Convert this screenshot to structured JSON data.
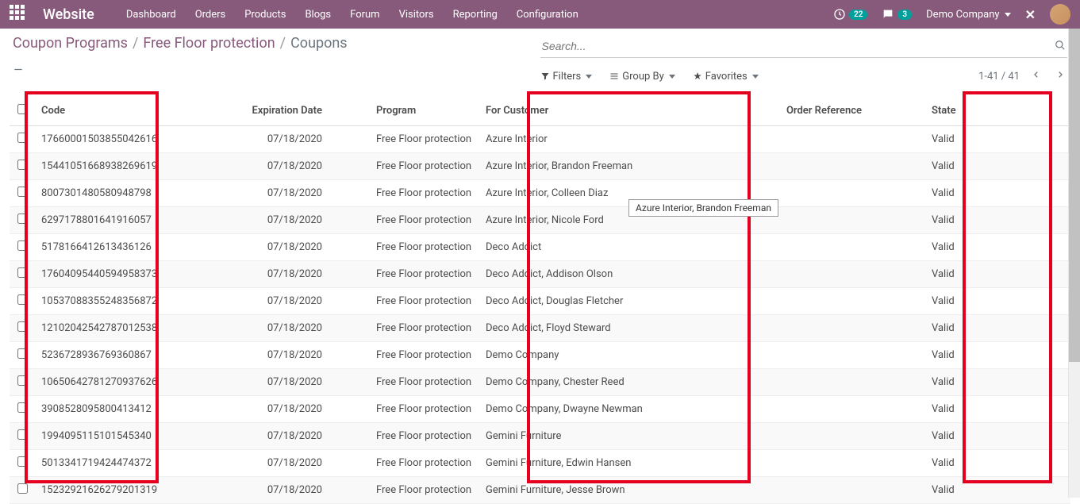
{
  "navbar": {
    "brand": "Website",
    "menu": [
      "Dashboard",
      "Orders",
      "Products",
      "Blogs",
      "Forum",
      "Visitors",
      "Reporting",
      "Configuration"
    ],
    "clock_count": "22",
    "chat_count": "3",
    "company": "Demo Company"
  },
  "breadcrumb": {
    "items": [
      {
        "label": "Coupon Programs",
        "link": true
      },
      {
        "label": "Free Floor protection",
        "link": true
      },
      {
        "label": "Coupons",
        "link": false
      }
    ]
  },
  "search": {
    "placeholder": "Search..."
  },
  "filters": {
    "filters_label": "Filters",
    "groupby_label": "Group By",
    "favorites_label": "Favorites"
  },
  "pager": {
    "range": "1-41 / 41"
  },
  "table": {
    "headers": {
      "code": "Code",
      "expiration": "Expiration Date",
      "program": "Program",
      "customer": "For Customer",
      "order_ref": "Order Reference",
      "state": "State"
    },
    "rows": [
      {
        "code": "17660001503855042616",
        "exp": "07/18/2020",
        "program": "Free Floor protection",
        "customer": "Azure Interior",
        "order": "",
        "state": "Valid"
      },
      {
        "code": "15441051668938269619",
        "exp": "07/18/2020",
        "program": "Free Floor protection",
        "customer": "Azure Interior, Brandon Freeman",
        "order": "",
        "state": "Valid"
      },
      {
        "code": "8007301480580948798",
        "exp": "07/18/2020",
        "program": "Free Floor protection",
        "customer": "Azure Interior, Colleen Diaz",
        "order": "",
        "state": "Valid"
      },
      {
        "code": "6297178801641916057",
        "exp": "07/18/2020",
        "program": "Free Floor protection",
        "customer": "Azure Interior, Nicole Ford",
        "order": "",
        "state": "Valid"
      },
      {
        "code": "5178166412613436126",
        "exp": "07/18/2020",
        "program": "Free Floor protection",
        "customer": "Deco Addict",
        "order": "",
        "state": "Valid"
      },
      {
        "code": "17604095440594958373",
        "exp": "07/18/2020",
        "program": "Free Floor protection",
        "customer": "Deco Addict, Addison Olson",
        "order": "",
        "state": "Valid"
      },
      {
        "code": "10537088355248356872",
        "exp": "07/18/2020",
        "program": "Free Floor protection",
        "customer": "Deco Addict, Douglas Fletcher",
        "order": "",
        "state": "Valid"
      },
      {
        "code": "12102042542787012538",
        "exp": "07/18/2020",
        "program": "Free Floor protection",
        "customer": "Deco Addict, Floyd Steward",
        "order": "",
        "state": "Valid"
      },
      {
        "code": "5236728936769360867",
        "exp": "07/18/2020",
        "program": "Free Floor protection",
        "customer": "Demo Company",
        "order": "",
        "state": "Valid"
      },
      {
        "code": "10650642781270937626",
        "exp": "07/18/2020",
        "program": "Free Floor protection",
        "customer": "Demo Company, Chester Reed",
        "order": "",
        "state": "Valid"
      },
      {
        "code": "3908528095800413412",
        "exp": "07/18/2020",
        "program": "Free Floor protection",
        "customer": "Demo Company, Dwayne Newman",
        "order": "",
        "state": "Valid"
      },
      {
        "code": "1994095115101545340",
        "exp": "07/18/2020",
        "program": "Free Floor protection",
        "customer": "Gemini Furniture",
        "order": "",
        "state": "Valid"
      },
      {
        "code": "5013341719424474372",
        "exp": "07/18/2020",
        "program": "Free Floor protection",
        "customer": "Gemini Furniture, Edwin Hansen",
        "order": "",
        "state": "Valid"
      },
      {
        "code": "15232921626279201319",
        "exp": "07/18/2020",
        "program": "Free Floor protection",
        "customer": "Gemini Furniture, Jesse Brown",
        "order": "",
        "state": "Valid"
      }
    ]
  },
  "tooltip": {
    "text": "Azure Interior, Brandon Freeman"
  }
}
